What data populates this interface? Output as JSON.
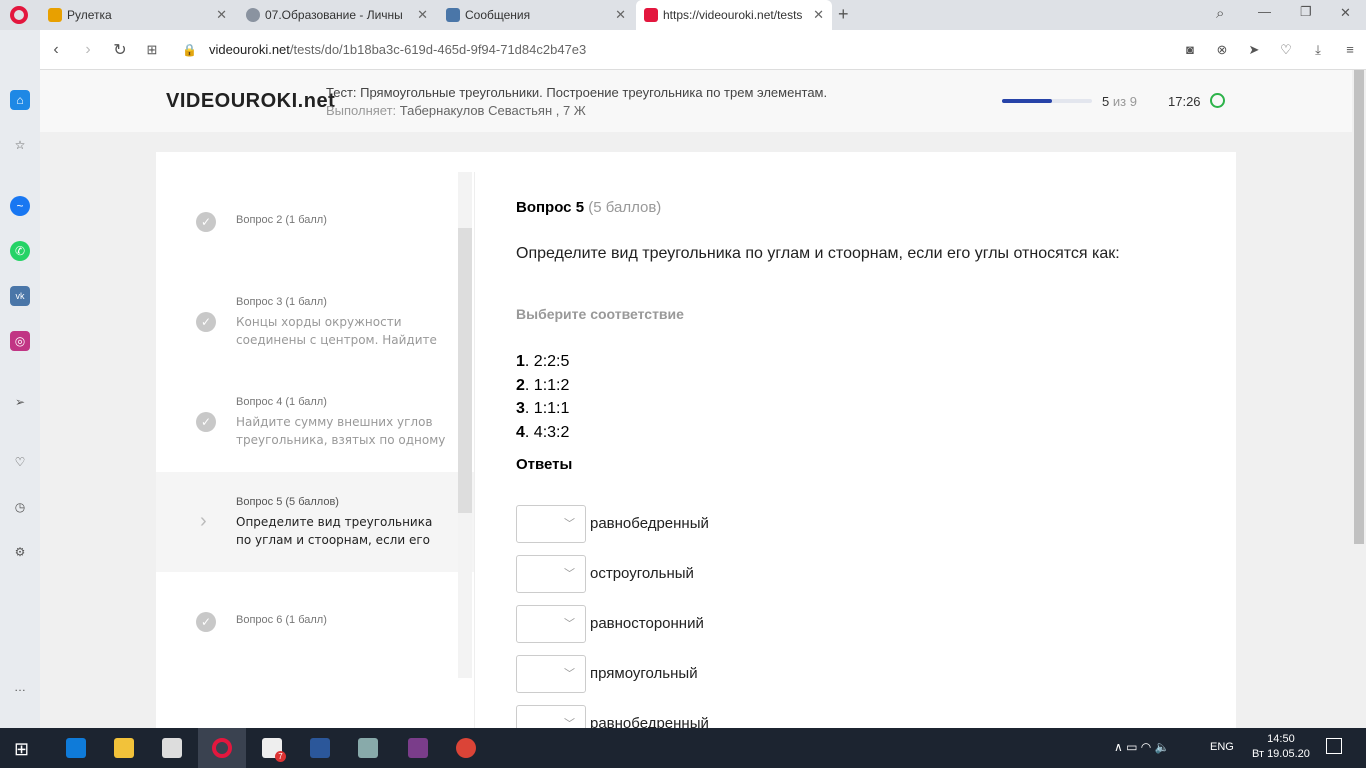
{
  "browser": {
    "tabs": [
      {
        "title": "Рулетка",
        "color": "#e8a000"
      },
      {
        "title": "07.Образование - Личны",
        "color": "#8a93a0"
      },
      {
        "title": "Сообщения",
        "color": "#4a76a8"
      },
      {
        "title": "https://videouroki.net/tests",
        "color": "#e3173e"
      }
    ],
    "url_domain": "videouroki.net",
    "url_path": "/tests/do/1b18ba3c-619d-465d-9f94-71d84c2b47e3"
  },
  "header": {
    "logo": "VIDEOUROKI.net",
    "test_title": "Тест: Прямоугольные треугольники. Построение треугольника по трем элементам.",
    "performer_label": "Выполняет:",
    "performer": "Табернакулов Севастьян , 7 Ж",
    "progress_text": "5",
    "progress_of": "из 9",
    "progress_fraction": 0.56,
    "timer": "17:26"
  },
  "sidebar": {
    "items": [
      {
        "head": "Вопрос 2 (1 балл)",
        "text": ""
      },
      {
        "head": "Вопрос 3 (1 балл)",
        "text": "Концы хорды окружности соединены с центром. Найдите"
      },
      {
        "head": "Вопрос 4 (1 балл)",
        "text": "Найдите сумму внешних углов треугольника, взятых по одному"
      },
      {
        "head": "Вопрос 5 (5 баллов)",
        "text": "Определите вид треугольника по углам и стоорнам, если его"
      },
      {
        "head": "Вопрос 6 (1 балл)",
        "text": ""
      }
    ]
  },
  "question": {
    "title": "Вопрос 5",
    "points": "(5 баллов)",
    "text": "Определите вид треугольника по углам и стоорнам, если его углы относятся как:",
    "instruction": "Выберите соответствие",
    "items": [
      {
        "n": "1",
        "v": "2:2:5"
      },
      {
        "n": "2",
        "v": "1:1:2"
      },
      {
        "n": "3",
        "v": "1:1:1"
      },
      {
        "n": "4",
        "v": "4:3:2"
      }
    ],
    "answers_label": "Ответы",
    "answers": [
      "равнобедренный",
      "остроугольный",
      "равносторонний",
      "прямоугольный",
      "равнобедренный"
    ]
  },
  "taskbar": {
    "lang": "ENG",
    "time": "14:50",
    "date": "Вт 19.05.20",
    "badge": "7"
  }
}
